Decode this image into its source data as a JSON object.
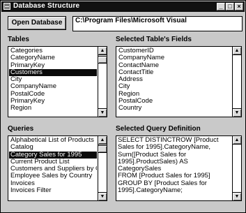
{
  "window": {
    "title": "Database Structure",
    "controls": {
      "minimize": "_",
      "maximize": "□",
      "close": "×"
    }
  },
  "toolbar": {
    "open_database_label": "Open Database",
    "database_path": "C:\\Program Files\\Microsoft Visual"
  },
  "tables": {
    "label": "Tables",
    "items": [
      "Categories",
      "CategoryName",
      "PrimaryKey",
      "Customers",
      "City",
      "CompanyName",
      "PostalCode",
      "PrimaryKey",
      "Region"
    ],
    "selected_index": 3
  },
  "fields": {
    "label": "Selected Table's Fields",
    "items": [
      "CustomerID",
      "CompanyName",
      "ContactName",
      "ContactTitle",
      "Address",
      "City",
      "Region",
      "PostalCode",
      "Country"
    ]
  },
  "queries": {
    "label": "Queries",
    "items": [
      "Alphabetical List of Products",
      "Catalog",
      "Category Sales for 1995",
      "Current Product List",
      "Customers and Suppliers by C",
      "Employee Sales by Country",
      "Invoices",
      "Invoices Filter"
    ],
    "selected_index": 2
  },
  "query_definition": {
    "label": "Selected Query Definition",
    "text": "SELECT DISTINCTROW [Product\nSales for 1995].CategoryName,\nSum([Product Sales for\n1995].ProductSales) AS CategorySales\nFROM [Product Sales for 1995]\nGROUP BY [Product Sales for\n1995].CategoryName;"
  },
  "scrollbar": {
    "up_glyph": "▲",
    "down_glyph": "▼"
  }
}
